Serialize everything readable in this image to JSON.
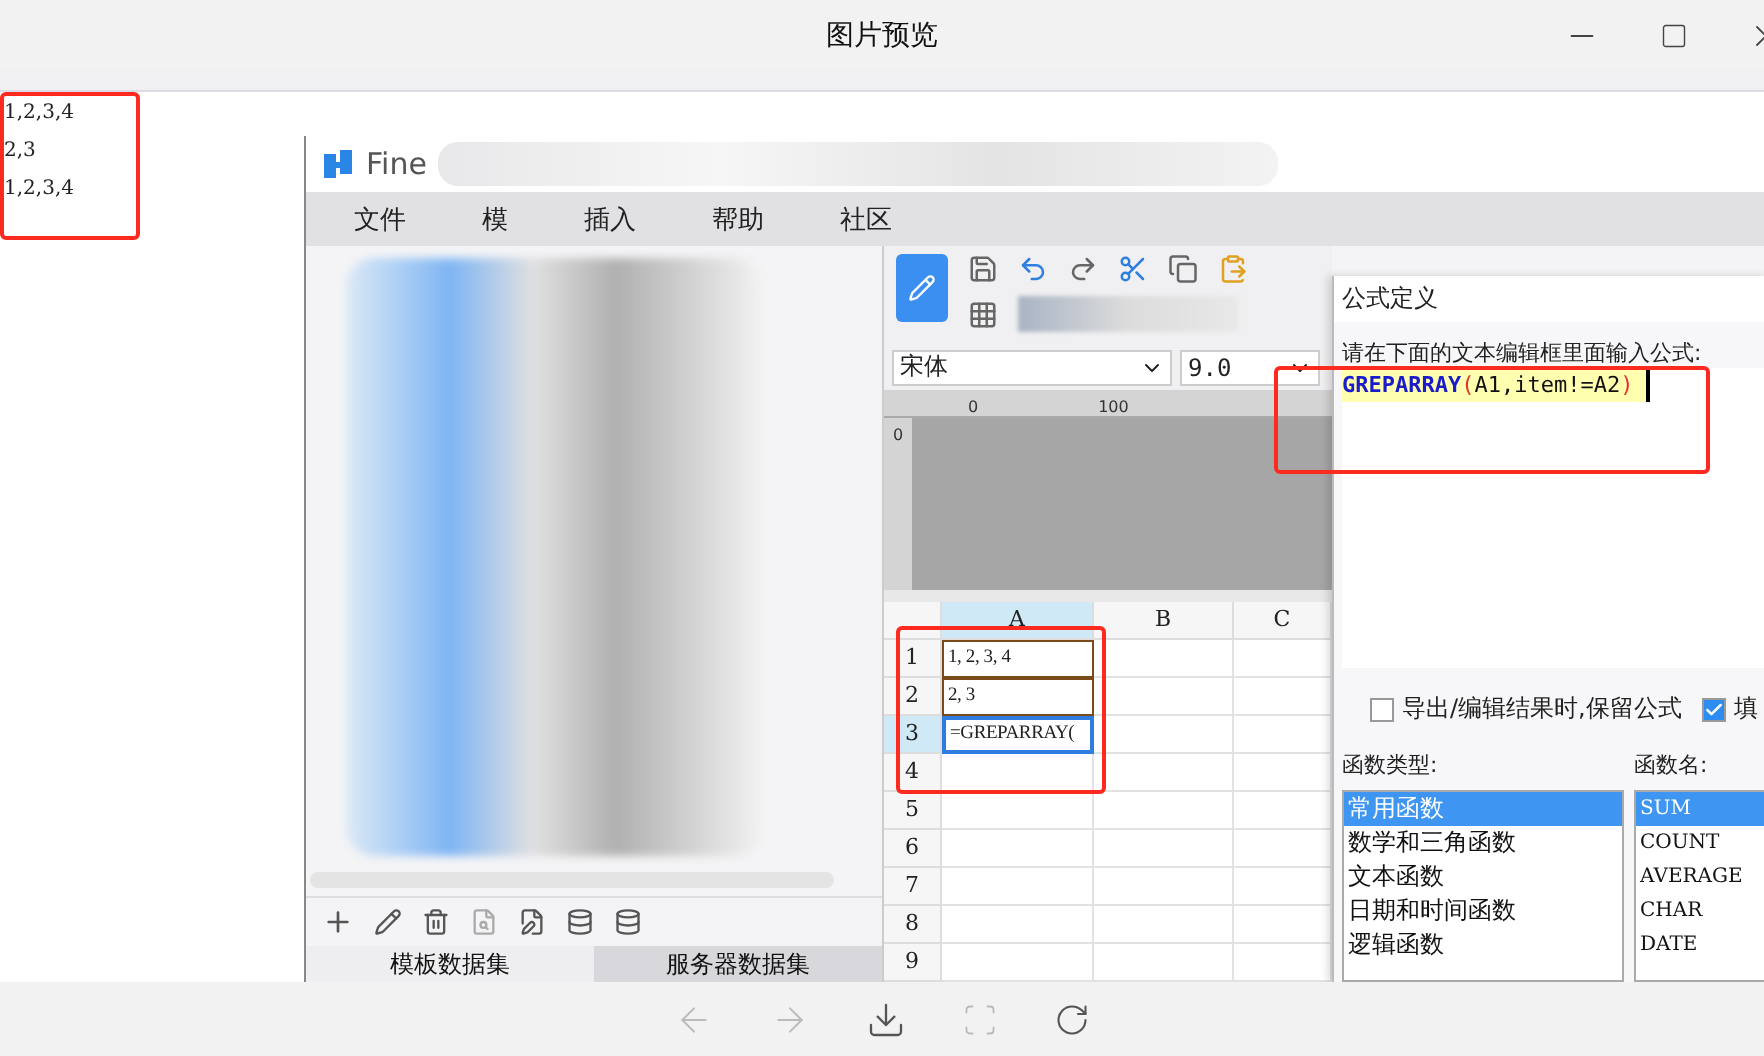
{
  "window": {
    "title": "图片预览"
  },
  "note": {
    "lines": [
      "1,2,3,4",
      "2,3",
      "1,2,3,4"
    ]
  },
  "app": {
    "title": "Fine",
    "menu": [
      "文件",
      "模",
      "插入",
      "帮助",
      "社区"
    ]
  },
  "left_panel": {
    "tabs": [
      {
        "label": "模板数据集",
        "selected": false
      },
      {
        "label": "服务器数据集",
        "selected": true
      }
    ]
  },
  "format_bar": {
    "font": "宋体",
    "size": "9.0"
  },
  "ruler": {
    "marks": [
      "0",
      "100"
    ],
    "side_mark": "0"
  },
  "sheet": {
    "columns": [
      {
        "label": "A",
        "selected": true
      },
      {
        "label": "B",
        "selected": false
      },
      {
        "label": "C",
        "selected": false
      }
    ],
    "rows": [
      {
        "label": "1",
        "selected": false,
        "cell": "1, 2, 3, 4"
      },
      {
        "label": "2",
        "selected": false,
        "cell": "2, 3"
      },
      {
        "label": "3",
        "selected": true,
        "cell": "=GREPARRAY("
      },
      {
        "label": "4",
        "selected": false
      },
      {
        "label": "5",
        "selected": false
      },
      {
        "label": "6",
        "selected": false
      },
      {
        "label": "7",
        "selected": false
      },
      {
        "label": "8",
        "selected": false
      },
      {
        "label": "9",
        "selected": false
      }
    ]
  },
  "dialog": {
    "title": "公式定义",
    "prompt": "请在下面的文本编辑框里面输入公式:",
    "formula": [
      {
        "text": "GREPARRAY",
        "kind": "function"
      },
      {
        "text": "(",
        "kind": "paren"
      },
      {
        "text": "A1,item!=A2",
        "kind": "arg"
      },
      {
        "text": ")",
        "kind": "paren"
      }
    ],
    "options": [
      {
        "label": "导出/编辑结果时,保留公式",
        "checked": false
      },
      {
        "label": "填",
        "checked": true
      }
    ],
    "type_label": "函数类型:",
    "name_label": "函数名:",
    "types": [
      {
        "label": "常用函数",
        "selected": true
      },
      {
        "label": "数学和三角函数",
        "selected": false
      },
      {
        "label": "文本函数",
        "selected": false
      },
      {
        "label": "日期和时间函数",
        "selected": false
      },
      {
        "label": "逻辑函数",
        "selected": false
      }
    ],
    "names": [
      {
        "label": "SUM",
        "selected": true
      },
      {
        "label": "COUNT",
        "selected": false
      },
      {
        "label": "AVERAGE",
        "selected": false
      },
      {
        "label": "CHAR",
        "selected": false
      },
      {
        "label": "DATE",
        "selected": false
      }
    ]
  }
}
